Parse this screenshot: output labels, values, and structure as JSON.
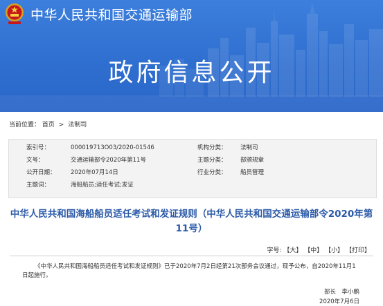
{
  "header": {
    "ministry_name": "中华人民共和国交通运输部",
    "banner_title": "政府信息公开"
  },
  "breadcrumb": {
    "label": "当前位置：",
    "items": [
      "首页",
      "法制司"
    ],
    "separator": ">"
  },
  "info": {
    "rows": [
      {
        "label1": "索引号：",
        "value1": "000019713O03/2020-01546",
        "label2": "机构分类：",
        "value2": "法制司"
      },
      {
        "label1": "文号：",
        "value1": "交通运输部令2020年第11号",
        "label2": "主题分类：",
        "value2": "部颁规章"
      },
      {
        "label1": "公开日期：",
        "value1": "2020年07月14日",
        "label2": "行业分类：",
        "value2": "船员管理"
      },
      {
        "label1": "主题词：",
        "value1": "海船船员;适任考试;发证",
        "label2": "",
        "value2": ""
      }
    ]
  },
  "document": {
    "title": "中华人民共和国海船船员适任考试和发证规则（中华人民共和国交通运输部令2020年第11号）",
    "font_size": {
      "label": "字号:",
      "large": "【大】",
      "medium": "【中】",
      "small": "【小】",
      "print": "【打印】"
    },
    "body": "《中华人民共和国海船船员适任考试和发证规则》已于2020年7月2日经第21次部务会议通过，现予公布，自2020年11月1日起施行。",
    "signer": "部长　李小鹏",
    "date": "2020年7月6日"
  },
  "colors": {
    "banner": "#2f6fd0",
    "title_blue": "#2b5aa8",
    "info_bg": "#f3f3f3"
  }
}
